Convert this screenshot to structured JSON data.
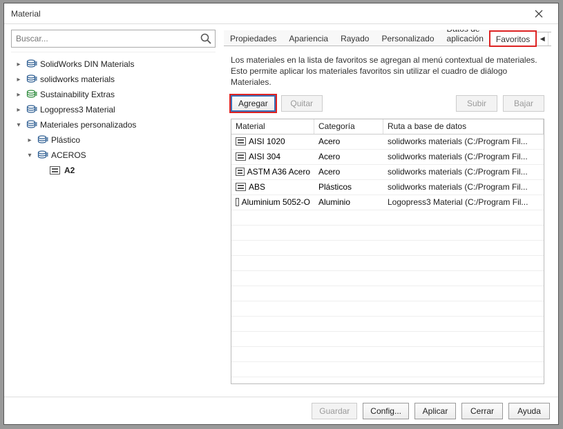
{
  "window": {
    "title": "Material"
  },
  "search": {
    "placeholder": "Buscar..."
  },
  "tree": [
    {
      "level": 0,
      "expandable": true,
      "expanded": false,
      "icon": "db",
      "label": "SolidWorks DIN Materials"
    },
    {
      "level": 0,
      "expandable": true,
      "expanded": false,
      "icon": "db",
      "label": "solidworks materials"
    },
    {
      "level": 0,
      "expandable": true,
      "expanded": false,
      "icon": "db-green",
      "label": "Sustainability Extras"
    },
    {
      "level": 0,
      "expandable": true,
      "expanded": false,
      "icon": "db",
      "label": "Logopress3 Material"
    },
    {
      "level": 0,
      "expandable": true,
      "expanded": true,
      "icon": "db",
      "label": "Materiales personalizados"
    },
    {
      "level": 1,
      "expandable": true,
      "expanded": false,
      "icon": "db",
      "label": "Plástico"
    },
    {
      "level": 1,
      "expandable": true,
      "expanded": true,
      "icon": "db",
      "label": "ACEROS"
    },
    {
      "level": 2,
      "expandable": false,
      "expanded": false,
      "icon": "mat",
      "label": "A2",
      "bold": true
    }
  ],
  "tabs": {
    "items": [
      "Propiedades",
      "Apariencia",
      "Rayado",
      "Personalizado",
      "Datos de aplicación",
      "Favoritos"
    ],
    "active": "Favoritos",
    "highlight": "Favoritos"
  },
  "favorites": {
    "description1": "Los materiales en la lista de favoritos se agregan al menú contextual de materiales.",
    "description2": "Esto permite aplicar los materiales favoritos sin utilizar el cuadro de diálogo Materiales.",
    "add_label": "Agregar",
    "remove_label": "Quitar",
    "up_label": "Subir",
    "down_label": "Bajar",
    "highlight_button": "Agregar",
    "columns": {
      "material": "Material",
      "categoria": "Categoría",
      "ruta": "Ruta a base de datos"
    },
    "rows": [
      {
        "material": "AISI 1020",
        "categoria": "Acero",
        "ruta": "solidworks materials (C:/Program Fil..."
      },
      {
        "material": "AISI 304",
        "categoria": "Acero",
        "ruta": "solidworks materials (C:/Program Fil..."
      },
      {
        "material": "ASTM A36 Acero",
        "categoria": "Acero",
        "ruta": "solidworks materials (C:/Program Fil..."
      },
      {
        "material": "ABS",
        "categoria": "Plásticos",
        "ruta": "solidworks materials (C:/Program Fil..."
      },
      {
        "material": "Aluminium 5052-O",
        "categoria": "Aluminio",
        "ruta": "Logopress3 Material (C:/Program Fil..."
      }
    ]
  },
  "footer": {
    "save": "Guardar",
    "config": "Config...",
    "apply": "Aplicar",
    "close": "Cerrar",
    "help": "Ayuda"
  }
}
